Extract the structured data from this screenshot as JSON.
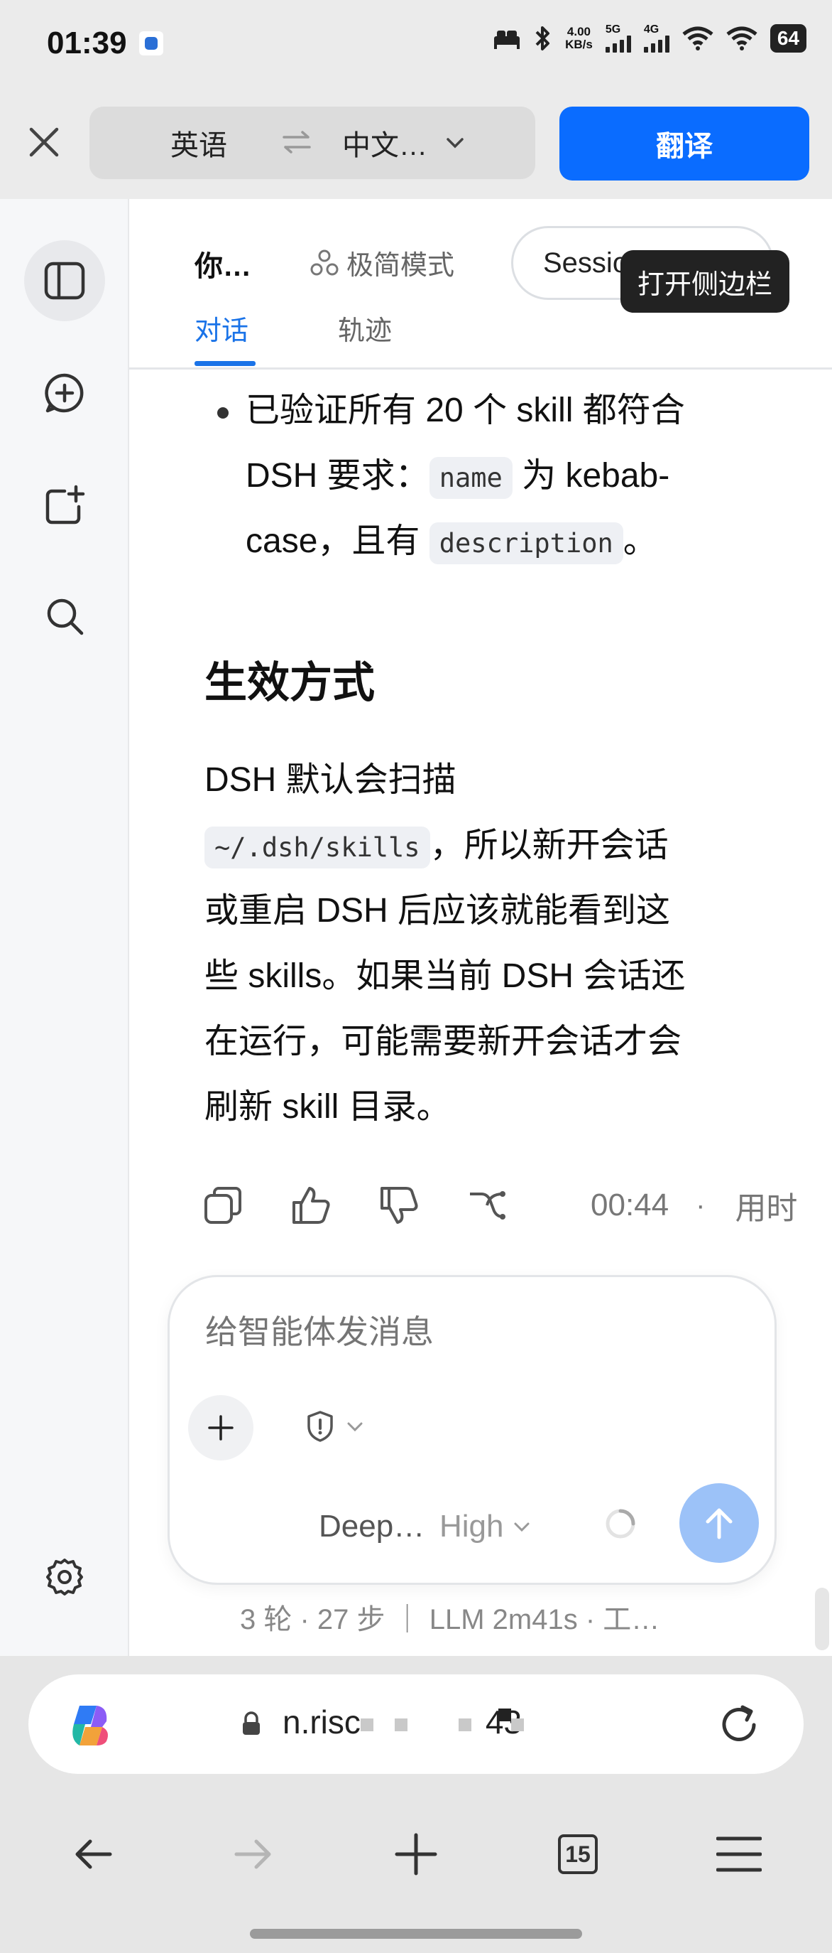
{
  "status_bar": {
    "time": "01:39",
    "net_speed_value": "4.00",
    "net_speed_unit": "KB/s",
    "sim1": "5G",
    "sim2": "4G",
    "battery": "64",
    "icons": [
      "app-notification-icon",
      "bed-icon",
      "bluetooth-icon",
      "signal-5g-icon",
      "signal-4g-icon",
      "wifi-icon",
      "wifi-icon",
      "battery-icon"
    ]
  },
  "translate_bar": {
    "source_lang": "英语",
    "target_lang": "中文…",
    "translate_button": "翻译"
  },
  "header": {
    "title": "你…",
    "mode_label": "极简模式",
    "session_label": "Session",
    "tooltip": "打开侧边栏",
    "tabs": [
      {
        "label": "对话",
        "active": true
      },
      {
        "label": "轨迹",
        "active": false
      }
    ]
  },
  "message": {
    "bullet_line1": "已验证所有 20 个 skill 都符合",
    "bullet_line2_pre": "DSH 要求：",
    "bullet_code1": "name",
    "bullet_line2_post": " 为 kebab-",
    "bullet_line3_pre": "case，且有 ",
    "bullet_code2": "description",
    "bullet_line3_post": "。",
    "heading": "生效方式",
    "para_line1": "DSH 默认会扫描",
    "para_code": "~/.dsh/skills",
    "para_line2_post": "，所以新开会话",
    "para_line3": "或重启 DSH 后应该就能看到这",
    "para_line4": "些 skills。如果当前 DSH 会话还",
    "para_line5": "在运行，可能需要新开会话才会",
    "para_line6": "刷新 skill 目录。"
  },
  "message_actions": {
    "time": "00:44",
    "separator": "·",
    "duration_label": "用时"
  },
  "composer": {
    "placeholder": "给智能体发消息",
    "model": "Deep…",
    "effort": "High"
  },
  "stats": "3 轮 · 27 步  ｜  LLM 2m41s · 工…",
  "browser": {
    "url_start": "n.risc",
    "url_end": "43",
    "tab_count": "15"
  },
  "colors": {
    "accent": "#1a73e8",
    "translate_button": "#0a6cff",
    "send_button": "#9cc2f8"
  }
}
